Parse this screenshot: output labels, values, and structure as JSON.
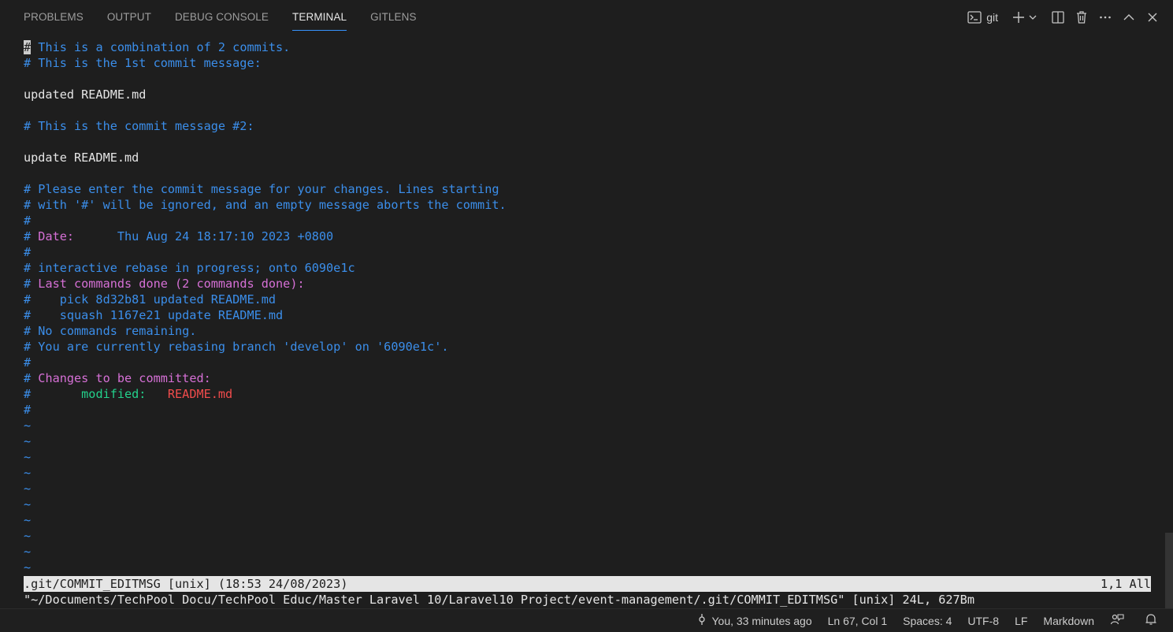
{
  "panel": {
    "tabs": [
      {
        "label": "PROBLEMS"
      },
      {
        "label": "OUTPUT"
      },
      {
        "label": "DEBUG CONSOLE"
      },
      {
        "label": "TERMINAL"
      },
      {
        "label": "GITLENS"
      }
    ],
    "active_tab": "TERMINAL",
    "terminal_name": "git",
    "icons": [
      "terminal-icon",
      "plus-icon",
      "chevron-down-icon",
      "split-icon",
      "trash-icon",
      "more-icon",
      "chevron-up-icon",
      "close-icon"
    ]
  },
  "terminal": {
    "lines": [
      [
        {
          "t": "#",
          "c": "cursor"
        },
        {
          "t": " This is a combination of 2 commits.",
          "c": "blue"
        }
      ],
      [
        {
          "t": "# This is the 1st commit message:",
          "c": "blue"
        }
      ],
      [],
      [
        {
          "t": "updated README.md",
          "c": "text"
        }
      ],
      [],
      [
        {
          "t": "# This is the commit message #2:",
          "c": "blue"
        }
      ],
      [],
      [
        {
          "t": "update README.md",
          "c": "text"
        }
      ],
      [],
      [
        {
          "t": "# Please enter the commit message for your changes. Lines starting",
          "c": "blue"
        }
      ],
      [
        {
          "t": "# with '#' will be ignored, and an empty message aborts the commit.",
          "c": "blue"
        }
      ],
      [
        {
          "t": "#",
          "c": "blue"
        }
      ],
      [
        {
          "t": "# ",
          "c": "blue"
        },
        {
          "t": "Date:",
          "c": "mag"
        },
        {
          "t": "      Thu Aug 24 18:17:10 2023 +0800",
          "c": "blue"
        }
      ],
      [
        {
          "t": "#",
          "c": "blue"
        }
      ],
      [
        {
          "t": "# interactive rebase in progress; onto 6090e1c",
          "c": "blue"
        }
      ],
      [
        {
          "t": "# ",
          "c": "blue"
        },
        {
          "t": "Last commands done (2 commands done):",
          "c": "mag"
        }
      ],
      [
        {
          "t": "#    pick 8d32b81 updated README.md",
          "c": "blue"
        }
      ],
      [
        {
          "t": "#    squash 1167e21 update README.md",
          "c": "blue"
        }
      ],
      [
        {
          "t": "# No commands remaining.",
          "c": "blue"
        }
      ],
      [
        {
          "t": "# You are currently rebasing branch 'develop' on '6090e1c'.",
          "c": "blue"
        }
      ],
      [
        {
          "t": "#",
          "c": "blue"
        }
      ],
      [
        {
          "t": "# ",
          "c": "blue"
        },
        {
          "t": "Changes to be committed:",
          "c": "mag"
        }
      ],
      [
        {
          "t": "#",
          "c": "blue"
        },
        {
          "t": "       modified:   ",
          "c": "green"
        },
        {
          "t": "README.md",
          "c": "red"
        }
      ],
      [
        {
          "t": "#",
          "c": "blue"
        }
      ],
      [
        {
          "t": "~",
          "c": "blue"
        }
      ],
      [
        {
          "t": "~",
          "c": "blue"
        }
      ],
      [
        {
          "t": "~",
          "c": "blue"
        }
      ],
      [
        {
          "t": "~",
          "c": "blue"
        }
      ],
      [
        {
          "t": "~",
          "c": "blue"
        }
      ],
      [
        {
          "t": "~",
          "c": "blue"
        }
      ],
      [
        {
          "t": "~",
          "c": "blue"
        }
      ],
      [
        {
          "t": "~",
          "c": "blue"
        }
      ],
      [
        {
          "t": "~",
          "c": "blue"
        }
      ],
      [
        {
          "t": "~",
          "c": "blue"
        }
      ]
    ],
    "status_left": ".git/COMMIT_EDITMSG [unix] (18:53 24/08/2023)",
    "status_right": "1,1 All",
    "message": "\"~/Documents/TechPool Docu/TechPool Educ/Master Laravel 10/Laravel10 Project/event-management/.git/COMMIT_EDITMSG\" [unix] 24L, 627Bm"
  },
  "statusbar": {
    "blame": "You, 33 minutes ago",
    "position": "Ln 67, Col 1",
    "spaces": "Spaces: 4",
    "encoding": "UTF-8",
    "eol": "LF",
    "language": "Markdown"
  }
}
